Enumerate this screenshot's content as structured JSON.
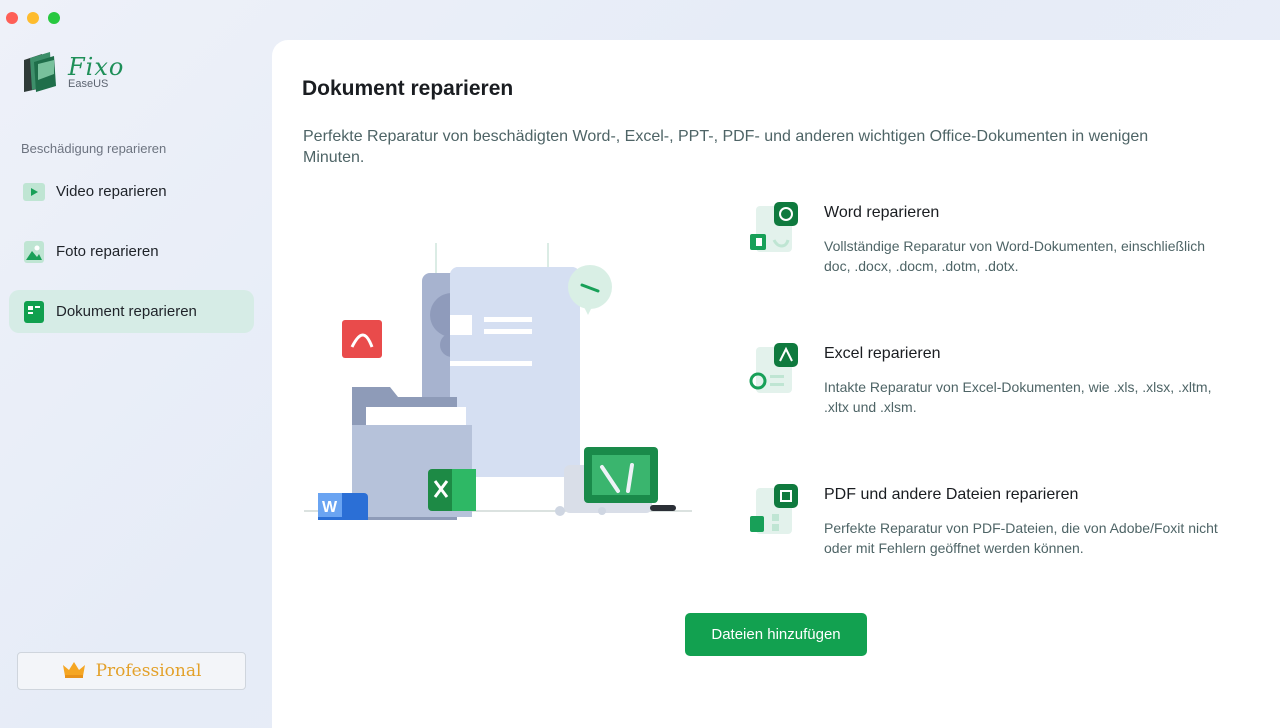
{
  "window": {
    "controls": [
      "close",
      "minimize",
      "maximize"
    ]
  },
  "app": {
    "name": "Fixo",
    "vendor": "EaseUS"
  },
  "sidebar": {
    "section_label": "Beschädigung reparieren",
    "items": [
      {
        "label": "Video reparieren",
        "icon": "video-play-icon",
        "active": false
      },
      {
        "label": "Foto reparieren",
        "icon": "photo-icon",
        "active": false
      },
      {
        "label": "Dokument reparieren",
        "icon": "document-icon",
        "active": true
      }
    ],
    "pro_label": "Professional",
    "pro_icon": "crown-icon"
  },
  "main": {
    "title": "Dokument reparieren",
    "description": "Perfekte Reparatur von beschädigten Word-, Excel-, PPT-, PDF- und anderen wichtigen Office-Dokumenten in wenigen Minuten.",
    "features": [
      {
        "title": "Word reparieren",
        "description": "Vollständige Reparatur von Word-Dokumenten, einschließlich doc, .docx, .docm, .dotm, .dotx.",
        "icon": "word-repair-icon"
      },
      {
        "title": "Excel reparieren",
        "description": "Intakte Reparatur von Excel-Dokumenten, wie .xls, .xlsx, .xltm, .xltx und .xlsm.",
        "icon": "excel-repair-icon"
      },
      {
        "title": "PDF und andere Dateien reparieren",
        "description": "Perfekte Reparatur von PDF-Dateien, die von Adobe/Foxit nicht oder mit Fehlern geöffnet werden können.",
        "icon": "pdf-repair-icon"
      }
    ],
    "add_button": "Dateien hinzufügen"
  },
  "colors": {
    "accent": "#12a150",
    "active_nav": "#d6ece6",
    "pro_text": "#e3a12a"
  }
}
